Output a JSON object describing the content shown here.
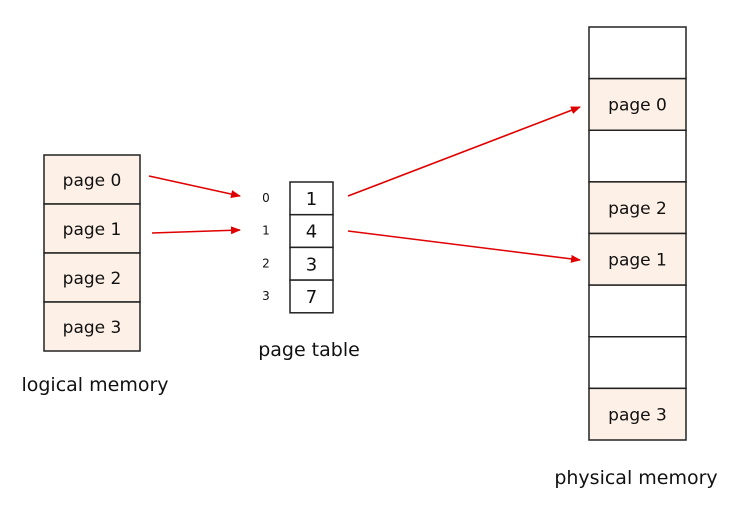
{
  "colors": {
    "page_fill": "#fdf0e6",
    "empty_fill": "#ffffff",
    "border": "#222222",
    "arrow": "#e00000"
  },
  "logical_memory": {
    "label": "logical memory",
    "pages": [
      "page 0",
      "page 1",
      "page 2",
      "page 3"
    ]
  },
  "page_table": {
    "label": "page table",
    "indices": [
      "0",
      "1",
      "2",
      "3"
    ],
    "frames": [
      "1",
      "4",
      "3",
      "7"
    ]
  },
  "physical_memory": {
    "label": "physical memory",
    "frames": [
      "",
      "page 0",
      "",
      "page 2",
      "page 1",
      "",
      "",
      "page 3"
    ]
  },
  "arrows": [
    {
      "from": "logical page 0",
      "to": "page table entry 0"
    },
    {
      "from": "logical page 1",
      "to": "page table entry 1"
    },
    {
      "from": "page table entry 0",
      "to": "physical frame 1"
    },
    {
      "from": "page table entry 1",
      "to": "physical frame 4"
    }
  ]
}
